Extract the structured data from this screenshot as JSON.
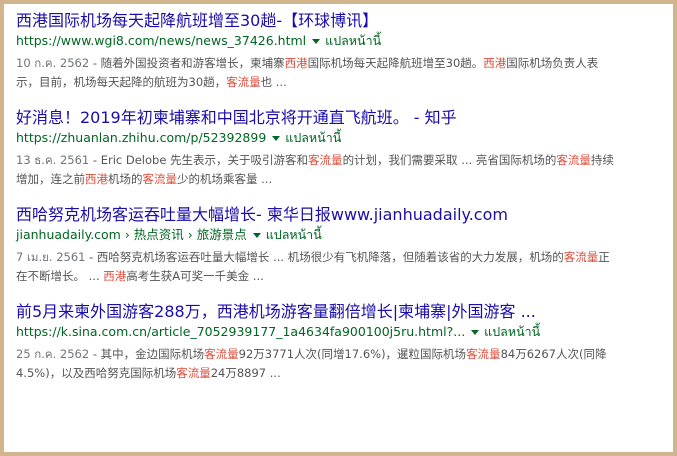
{
  "translate_label": "แปลหน้านี้",
  "results": [
    {
      "title": "西港国际机场每天起降航班增至30趟-【环球博讯】",
      "url": "https://www.wgi8.com/news/news_37426.html",
      "date": "10 ก.ค. 2562",
      "snippet": [
        {
          "t": " - 随着外国投资者和游客增长，柬埔寨"
        },
        {
          "t": "西港",
          "em": true
        },
        {
          "t": "国际机场每天起降航班增至30趟。"
        },
        {
          "t": "西港",
          "em": true
        },
        {
          "t": "国际机场负责人表示，目前，机场每天起降的航班为30趟，"
        },
        {
          "t": "客流量",
          "em": true
        },
        {
          "t": "也 ..."
        }
      ]
    },
    {
      "title": "好消息！2019年初柬埔寨和中国北京将开通直飞航班。 - 知乎",
      "url": "https://zhuanlan.zhihu.com/p/52392899",
      "date": "13 ธ.ค. 2561",
      "snippet": [
        {
          "t": " - Eric Delobe 先生表示，关于吸引游客和"
        },
        {
          "t": "客流量",
          "em": true
        },
        {
          "t": "的计划，我们需要采取 ... 亮省国际机场的"
        },
        {
          "t": "客流量",
          "em": true
        },
        {
          "t": "持续增加，连之前"
        },
        {
          "t": "西港",
          "em": true
        },
        {
          "t": "机场的"
        },
        {
          "t": "客流量",
          "em": true
        },
        {
          "t": "少的机场乘客量 ..."
        }
      ]
    },
    {
      "title": "西哈努克机场客运吞吐量大幅增长- 柬华日报www.jianhuadaily.com",
      "url": "jianhuadaily.com › 热点资讯 › 旅游景点",
      "date": "7 เม.ย. 2561",
      "snippet": [
        {
          "t": " - 西哈努克机场客运吞吐量大幅增长 ... 机场很少有飞机降落，但随着该省的大力发展，机场的"
        },
        {
          "t": "客流量",
          "em": true
        },
        {
          "t": "正在不断增长。 ... "
        },
        {
          "t": "西港",
          "em": true
        },
        {
          "t": "高考生获A可奖一千美金 ..."
        }
      ]
    },
    {
      "title": "前5月来柬外国游客288万，西港机场游客量翻倍增长|柬埔寨|外国游客 ...",
      "url": "https://k.sina.com.cn/article_7052939177_1a4634fa900100j5ru.html?...",
      "date": "25 ก.ค. 2562",
      "snippet": [
        {
          "t": " - 其中，金边国际机场"
        },
        {
          "t": "客流量",
          "em": true
        },
        {
          "t": "92万3771人次(同增17.6%)，暹粒国际机场"
        },
        {
          "t": "客流量",
          "em": true
        },
        {
          "t": "84万6267人次(同降4.5%)，以及西哈努克国际机场"
        },
        {
          "t": "客流量",
          "em": true
        },
        {
          "t": "24万8897 ..."
        }
      ]
    }
  ]
}
